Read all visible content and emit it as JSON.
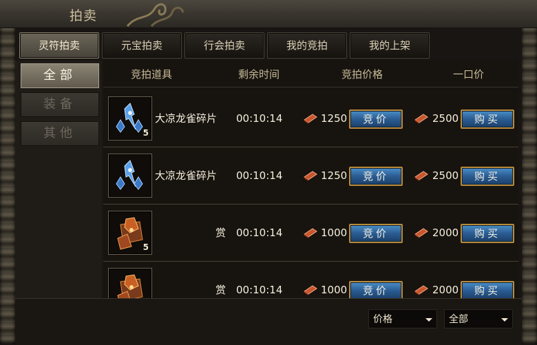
{
  "window": {
    "title": "拍卖"
  },
  "tabs": [
    {
      "label": "灵符拍卖",
      "active": true
    },
    {
      "label": "元宝拍卖",
      "active": false
    },
    {
      "label": "行会拍卖",
      "active": false
    },
    {
      "label": "我的竞拍",
      "active": false
    },
    {
      "label": "我的上架",
      "active": false
    }
  ],
  "categories": [
    {
      "label": "全部",
      "active": true
    },
    {
      "label": "装备",
      "active": false
    },
    {
      "label": "其他",
      "active": false
    }
  ],
  "columns": {
    "item": "竞拍道具",
    "time": "剩余时间",
    "bid_price": "竞拍价格",
    "buyout_price": "一口价"
  },
  "rows": [
    {
      "icon": "blue-crystal-shard-icon",
      "qty": "5",
      "name": "大凉龙雀碎片",
      "time": "00:10:14",
      "bid": "1250",
      "buyout": "2500",
      "bid_button": "竞价",
      "buy_button": "购买"
    },
    {
      "icon": "blue-crystal-shard-icon",
      "qty": "",
      "name": "大凉龙雀碎片",
      "time": "00:10:14",
      "bid": "1250",
      "buyout": "2500",
      "bid_button": "竞价",
      "buy_button": "购买"
    },
    {
      "icon": "fire-treasure-chest-icon",
      "qty": "5",
      "name": "赏",
      "time": "00:10:14",
      "bid": "1000",
      "buyout": "2000",
      "bid_button": "竞价",
      "buy_button": "购买"
    },
    {
      "icon": "fire-treasure-chest-icon",
      "qty": "",
      "name": "赏",
      "time": "00:10:14",
      "bid": "1000",
      "buyout": "2000",
      "bid_button": "竞价",
      "buy_button": "购买"
    }
  ],
  "filters": {
    "sort": "价格",
    "type": "全部"
  },
  "colors": {
    "button_blue": "#2a5c92",
    "button_border": "#b98b3a",
    "currency": "#c9552e"
  },
  "currency_icon": "talisman-scroll-icon"
}
